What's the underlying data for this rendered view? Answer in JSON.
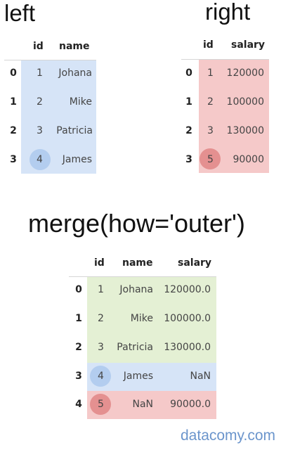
{
  "titles": {
    "left": "left",
    "right": "right",
    "merge": "merge(how='outer')"
  },
  "colors": {
    "left_band": "#d6e4f7",
    "right_band": "#f5c9c9",
    "both_band": "#e4f0d4",
    "left_circle": "#b3cdef",
    "right_circle": "#e49090",
    "header_line": "#d6d6d6",
    "footer_text": "#6b95cc"
  },
  "left_table": {
    "columns": [
      "id",
      "name"
    ],
    "rows": [
      {
        "index": "0",
        "id": "1",
        "name": "Johana"
      },
      {
        "index": "1",
        "id": "2",
        "name": "Mike"
      },
      {
        "index": "2",
        "id": "3",
        "name": "Patricia"
      },
      {
        "index": "3",
        "id": "4",
        "name": "James"
      }
    ]
  },
  "right_table": {
    "columns": [
      "id",
      "salary"
    ],
    "rows": [
      {
        "index": "0",
        "id": "1",
        "salary": "120000"
      },
      {
        "index": "1",
        "id": "2",
        "salary": "100000"
      },
      {
        "index": "2",
        "id": "3",
        "salary": "130000"
      },
      {
        "index": "3",
        "id": "5",
        "salary": "90000"
      }
    ]
  },
  "merged_table": {
    "columns": [
      "id",
      "name",
      "salary"
    ],
    "rows": [
      {
        "index": "0",
        "id": "1",
        "name": "Johana",
        "salary": "120000.0",
        "source": "both"
      },
      {
        "index": "1",
        "id": "2",
        "name": "Mike",
        "salary": "100000.0",
        "source": "both"
      },
      {
        "index": "2",
        "id": "3",
        "name": "Patricia",
        "salary": "130000.0",
        "source": "both"
      },
      {
        "index": "3",
        "id": "4",
        "name": "James",
        "salary": "NaN",
        "source": "left_only"
      },
      {
        "index": "4",
        "id": "5",
        "name": "NaN",
        "salary": "90000.0",
        "source": "right_only"
      }
    ]
  },
  "highlighted_ids": {
    "left_only": "4",
    "right_only": "5"
  },
  "footer": {
    "text": "datacomy.com"
  }
}
